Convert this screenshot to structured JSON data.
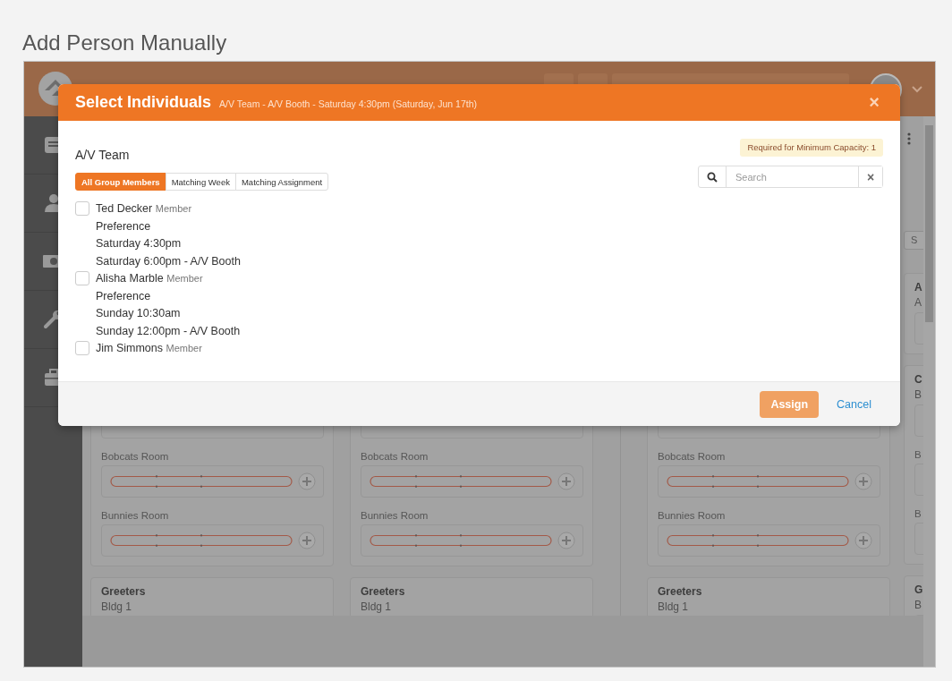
{
  "page_title": "Add Person Manually",
  "background": {
    "columns": [
      {
        "cards": [
          {
            "rooms": [
              "Bobcats Room",
              "Bunnies Room"
            ]
          },
          {
            "title": "Greeters",
            "subtitle": "Bldg 1"
          }
        ]
      },
      {
        "cards": [
          {
            "rooms": [
              "Bobcats Room",
              "Bunnies Room"
            ]
          },
          {
            "title": "Greeters",
            "subtitle": "Bldg 1"
          }
        ]
      },
      {
        "cards": [
          {
            "rooms": [
              "Bobcats Room",
              "Bunnies Room"
            ]
          },
          {
            "title": "Greeters",
            "subtitle": "Bldg 1"
          }
        ]
      },
      {
        "toolbar": {
          "filter_label": "S"
        },
        "cards": [
          {
            "title": "A",
            "subtitle": "A"
          },
          {
            "title": "C",
            "subtitle": "B",
            "rooms": [
              "B",
              "B"
            ]
          },
          {
            "title": "G",
            "subtitle": "B"
          }
        ]
      }
    ]
  },
  "modal": {
    "title": "Select Individuals",
    "subtitle": "A/V Team - A/V Booth - Saturday 4:30pm (Saturday, Jun 17th)",
    "close": "×",
    "group_name": "A/V Team",
    "capacity_badge": "Required for Minimum Capacity: 1",
    "tabs": [
      {
        "label": "All Group Members",
        "selected": true
      },
      {
        "label": "Matching Week",
        "selected": false
      },
      {
        "label": "Matching Assignment",
        "selected": false
      }
    ],
    "search": {
      "placeholder": "Search",
      "clear": "×"
    },
    "people": [
      {
        "name": "Ted Decker",
        "role": "Member",
        "checked": false,
        "details": [
          "Preference",
          "Saturday 4:30pm",
          "Saturday 6:00pm - A/V Booth"
        ]
      },
      {
        "name": "Alisha Marble",
        "role": "Member",
        "checked": false,
        "details": [
          "Preference",
          "Sunday 10:30am",
          "Sunday 12:00pm - A/V Booth"
        ]
      },
      {
        "name": "Jim Simmons",
        "role": "Member",
        "checked": false
      }
    ],
    "buttons": [
      {
        "label": "Assign",
        "kind": "primary"
      },
      {
        "label": "Cancel",
        "kind": "link"
      }
    ]
  }
}
